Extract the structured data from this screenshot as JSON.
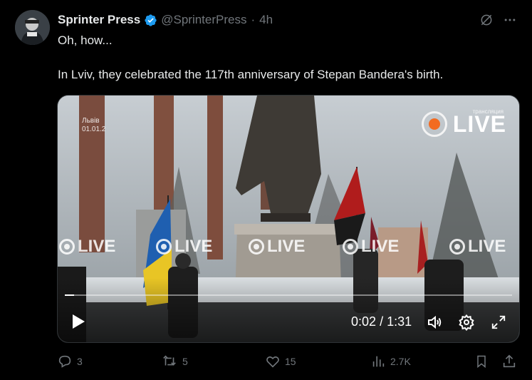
{
  "post": {
    "display_name": "Sprinter Press",
    "handle": "@SprinterPress",
    "separator": "·",
    "time": "4h",
    "text": "Oh, how...\n\nIn Lviv, they celebrated the 117th anniversary of Stepan Bandera's birth."
  },
  "video": {
    "logo_word": "LIVE",
    "logo_small": "трансляция",
    "watermark": "LIVE",
    "location_tag_line1": "Львів",
    "location_tag_line2": "01.01.2",
    "current_time": "0:02",
    "time_separator": "/",
    "duration": "1:31",
    "progress_fraction": 0.02
  },
  "actions": {
    "replies": "3",
    "reposts": "5",
    "likes": "15",
    "views": "2.7K"
  },
  "colors": {
    "background": "#000000",
    "text_primary": "#e7e9ea",
    "text_secondary": "#71767b",
    "verified": "#1d9bf0",
    "live_dot": "#f26b21"
  },
  "icons": {
    "verified": "verified-badge-icon",
    "grok": "grok-icon",
    "more": "more-icon",
    "play": "play-icon",
    "volume": "volume-icon",
    "settings": "gear-icon",
    "fullscreen": "fullscreen-icon",
    "reply": "reply-icon",
    "repost": "repost-icon",
    "like": "like-icon",
    "views": "views-icon",
    "bookmark": "bookmark-icon",
    "share": "share-icon"
  }
}
